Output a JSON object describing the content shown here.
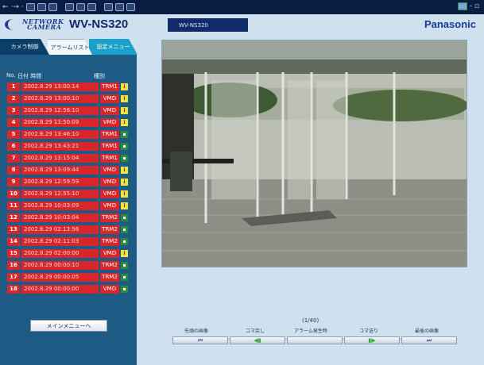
{
  "toolbar": {
    "icons": [
      "back-icon",
      "forward-icon",
      "stop-icon",
      "refresh-icon",
      "home-icon",
      "search-icon",
      "favorites-icon",
      "history-icon",
      "mail-icon",
      "print-icon",
      "edit-icon",
      "discuss-icon"
    ],
    "window_controls": "- ▫"
  },
  "header": {
    "brand_line1": "NETWORK",
    "brand_line2": "CAMERA",
    "model": "WV-NS320",
    "title": "WV-NS320",
    "maker": "Panasonic"
  },
  "tabs": [
    {
      "label": "カメラ制御"
    },
    {
      "label": "アラームリスト"
    },
    {
      "label": "設定メニュー"
    }
  ],
  "alarm_list": {
    "col_no": "No.",
    "col_datetime": "日付 時間",
    "col_type": "種別",
    "rows": [
      {
        "no": "1",
        "datetime": "2002.8.29 13:00:14",
        "type": "TRM1",
        "indicator": "i"
      },
      {
        "no": "2",
        "datetime": "2002.8.29 13:00:10",
        "type": "VMD",
        "indicator": "i"
      },
      {
        "no": "3",
        "datetime": "2002.8.29 12:56:10",
        "type": "VMD",
        "indicator": "i"
      },
      {
        "no": "4",
        "datetime": "2002.8.29 13:50:09",
        "type": "VMD",
        "indicator": "i"
      },
      {
        "no": "5",
        "datetime": "2002.8.29 13:46:10",
        "type": "TRM1",
        "indicator": "p"
      },
      {
        "no": "6",
        "datetime": "2002.8.29 13:43:21",
        "type": "TRM1",
        "indicator": "p"
      },
      {
        "no": "7",
        "datetime": "2002.8.29 13:15:04",
        "type": "TRM1",
        "indicator": "p"
      },
      {
        "no": "8",
        "datetime": "2002.8.29 13:09:44",
        "type": "VMD",
        "indicator": "i"
      },
      {
        "no": "9",
        "datetime": "2002.8.29 12:59:59",
        "type": "VMD",
        "indicator": "i"
      },
      {
        "no": "10",
        "datetime": "2002.8.29 12:55:10",
        "type": "VMD",
        "indicator": "i"
      },
      {
        "no": "11",
        "datetime": "2002.8.29 10:03:09",
        "type": "VMD",
        "indicator": "i"
      },
      {
        "no": "12",
        "datetime": "2002.8.29 10:03:04",
        "type": "TRM2",
        "indicator": "p"
      },
      {
        "no": "13",
        "datetime": "2002.8.29 02:13:56",
        "type": "TRM2",
        "indicator": "p"
      },
      {
        "no": "14",
        "datetime": "2002.8.29 02:11:03",
        "type": "TRM2",
        "indicator": "p"
      },
      {
        "no": "15",
        "datetime": "2002.8.29 02:00:00",
        "type": "VMD",
        "indicator": "i"
      },
      {
        "no": "16",
        "datetime": "2002.8.29 00:00:10",
        "type": "TRM2",
        "indicator": "p"
      },
      {
        "no": "17",
        "datetime": "2002.8.29 00:00:05",
        "type": "TRM2",
        "indicator": "p"
      },
      {
        "no": "18",
        "datetime": "2002.8.29 00:00:00",
        "type": "VMD",
        "indicator": "p"
      }
    ]
  },
  "main_menu_label": "メインメニューへ",
  "playback": {
    "counter": "(1/40)",
    "first_label": "先頭の画像",
    "prev_label": "コマ戻し",
    "alarm_label": "アラーム発生時",
    "next_label": "コマ送り",
    "last_label": "最後の画像",
    "first_icon": "skip-first-icon",
    "prev_icon": "step-back-icon",
    "next_icon": "step-forward-icon",
    "last_icon": "skip-last-icon"
  },
  "colors": {
    "row_red": "#d8262a",
    "panel_blue": "#1d5b84",
    "page_bg": "#cfe1ef"
  }
}
